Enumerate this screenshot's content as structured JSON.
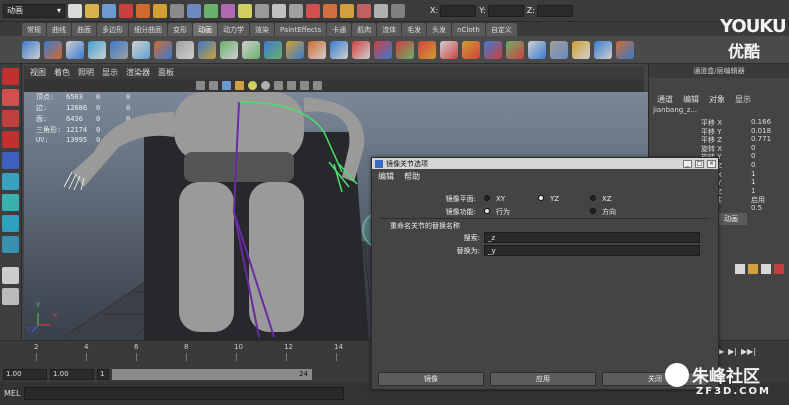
{
  "status_line": {
    "mode": "动画",
    "coord_labels": [
      "X:",
      "Y:",
      "Z:"
    ]
  },
  "shelf_tabs": [
    {
      "label": "常规",
      "active": false
    },
    {
      "label": "曲线",
      "active": false
    },
    {
      "label": "曲面",
      "active": false
    },
    {
      "label": "多边形",
      "active": false
    },
    {
      "label": "细分曲面",
      "active": false
    },
    {
      "label": "变形",
      "active": false
    },
    {
      "label": "动画",
      "active": true
    },
    {
      "label": "动力学",
      "active": false
    },
    {
      "label": "渲染",
      "active": false
    },
    {
      "label": "PaintEffects",
      "active": false
    },
    {
      "label": "卡通",
      "active": false
    },
    {
      "label": "肌肉",
      "active": false
    },
    {
      "label": "流体",
      "active": false
    },
    {
      "label": "毛发",
      "active": false
    },
    {
      "label": "头发",
      "active": false
    },
    {
      "label": "nCloth",
      "active": false
    },
    {
      "label": "自定义",
      "active": false
    }
  ],
  "viewport": {
    "menu": [
      "视图",
      "着色",
      "照明",
      "显示",
      "渲染器",
      "面板"
    ],
    "hud": [
      {
        "label": "顶点:",
        "v1": "6503",
        "v2": "0",
        "v3": "0"
      },
      {
        "label": "边:",
        "v1": "12686",
        "v2": "0",
        "v3": "0"
      },
      {
        "label": "面:",
        "v1": "6436",
        "v2": "0",
        "v3": "0"
      },
      {
        "label": "三角形:",
        "v1": "12174",
        "v2": "0",
        "v3": "0"
      },
      {
        "label": "UV:",
        "v1": "13995",
        "v2": "0",
        "v3": "0"
      }
    ],
    "axis_x": "x",
    "axis_y": "y",
    "axis_z": "z"
  },
  "channel_box": {
    "title": "通道盒/层编辑器",
    "menu": [
      "通道",
      "编辑",
      "对象",
      "显示"
    ],
    "object_name": "jianbang_z...",
    "attrs": [
      {
        "name": "平移 X",
        "value": "0.166"
      },
      {
        "name": "平移 Y",
        "value": "0.018"
      },
      {
        "name": "平移 Z",
        "value": "0.771"
      },
      {
        "name": "旋转 X",
        "value": "0"
      },
      {
        "name": "旋转 Y",
        "value": "0"
      },
      {
        "name": "旋转 Z",
        "value": "0"
      },
      {
        "name": "缩放 X",
        "value": "1"
      },
      {
        "name": "缩放 Y",
        "value": "1"
      },
      {
        "name": "缩放 Z",
        "value": "1"
      },
      {
        "name": "可见性",
        "value": "启用"
      },
      {
        "name": "半径",
        "value": "0.5"
      }
    ],
    "tab": "动画"
  },
  "timeline": {
    "ticks": [
      "2",
      "4",
      "6",
      "8",
      "10",
      "12",
      "14"
    ],
    "start": "1.00",
    "current": "1.00",
    "frame_field": "1",
    "end_frame": "24"
  },
  "command_line": {
    "label": "MEL"
  },
  "dialog": {
    "title": "镜像关节选项",
    "menu": [
      "编辑",
      "帮助"
    ],
    "mirror_plane_label": "镜像平面:",
    "mirror_plane_options": [
      {
        "label": "XY",
        "selected": false
      },
      {
        "label": "YZ",
        "selected": true
      },
      {
        "label": "XZ",
        "selected": false
      }
    ],
    "mirror_function_label": "镜像功能:",
    "mirror_function_options": [
      {
        "label": "行为",
        "selected": true
      },
      {
        "label": "方向",
        "selected": false
      }
    ],
    "section_title": "重命名关节的替换名称",
    "search_label": "搜索:",
    "search_value": "_z",
    "replace_label": "替换为:",
    "replace_value": "_y",
    "buttons": {
      "mirror": "镜像",
      "apply": "应用",
      "close": "关闭"
    }
  },
  "watermarks": {
    "youku_en": "YOUKU",
    "youku_cn": "优酷",
    "zf3d_cn": "朱峰社区",
    "zf3d_en": "ZF3D.COM"
  }
}
